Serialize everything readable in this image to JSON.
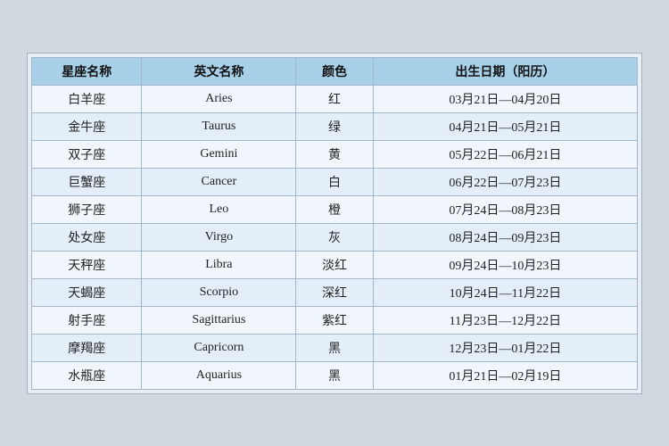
{
  "table": {
    "headers": {
      "zh_name": "星座名称",
      "en_name": "英文名称",
      "color": "颜色",
      "date_range": "出生日期（阳历）"
    },
    "rows": [
      {
        "zh": "白羊座",
        "en": "Aries",
        "color": "红",
        "date": "03月21日—04月20日"
      },
      {
        "zh": "金牛座",
        "en": "Taurus",
        "color": "绿",
        "date": "04月21日—05月21日"
      },
      {
        "zh": "双子座",
        "en": "Gemini",
        "color": "黄",
        "date": "05月22日—06月21日"
      },
      {
        "zh": "巨蟹座",
        "en": "Cancer",
        "color": "白",
        "date": "06月22日—07月23日"
      },
      {
        "zh": "狮子座",
        "en": "Leo",
        "color": "橙",
        "date": "07月24日—08月23日"
      },
      {
        "zh": "处女座",
        "en": "Virgo",
        "color": "灰",
        "date": "08月24日—09月23日"
      },
      {
        "zh": "天秤座",
        "en": "Libra",
        "color": "淡红",
        "date": "09月24日—10月23日"
      },
      {
        "zh": "天蝎座",
        "en": "Scorpio",
        "color": "深红",
        "date": "10月24日—11月22日"
      },
      {
        "zh": "射手座",
        "en": "Sagittarius",
        "color": "紫红",
        "date": "11月23日—12月22日"
      },
      {
        "zh": "摩羯座",
        "en": "Capricorn",
        "color": "黑",
        "date": "12月23日—01月22日"
      },
      {
        "zh": "水瓶座",
        "en": "Aquarius",
        "color": "黑",
        "date": "01月21日—02月19日"
      }
    ]
  }
}
